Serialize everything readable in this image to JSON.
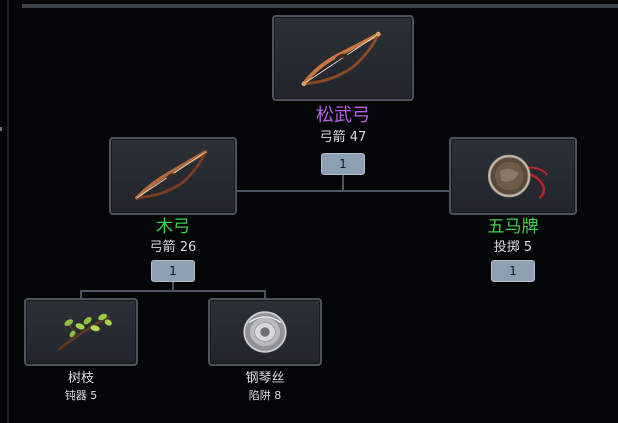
{
  "colors": {
    "background": "#040507",
    "slot_fill": "#2a2e34",
    "slot_border": "#4d535c",
    "rare_name": "#b760e6",
    "uncommon_name": "#3fd14f",
    "badge": "#8e9fb1",
    "connector": "#4d5560"
  },
  "top_item": {
    "name": "松武弓",
    "stat": "弓箭 47",
    "count": "1",
    "icon": "recurve-bow-icon"
  },
  "left_item": {
    "name": "木弓",
    "stat": "弓箭 26",
    "count": "1",
    "icon": "wooden-bow-icon"
  },
  "right_item": {
    "name": "五马牌",
    "stat": "投掷 5",
    "count": "1",
    "icon": "medallion-icon"
  },
  "branch_item": {
    "name": "树枝",
    "stat": "钝器 5",
    "icon": "leafy-branch-icon"
  },
  "wire_item": {
    "name": "钢琴丝",
    "stat": "陷阱 8",
    "icon": "wire-spool-icon"
  }
}
